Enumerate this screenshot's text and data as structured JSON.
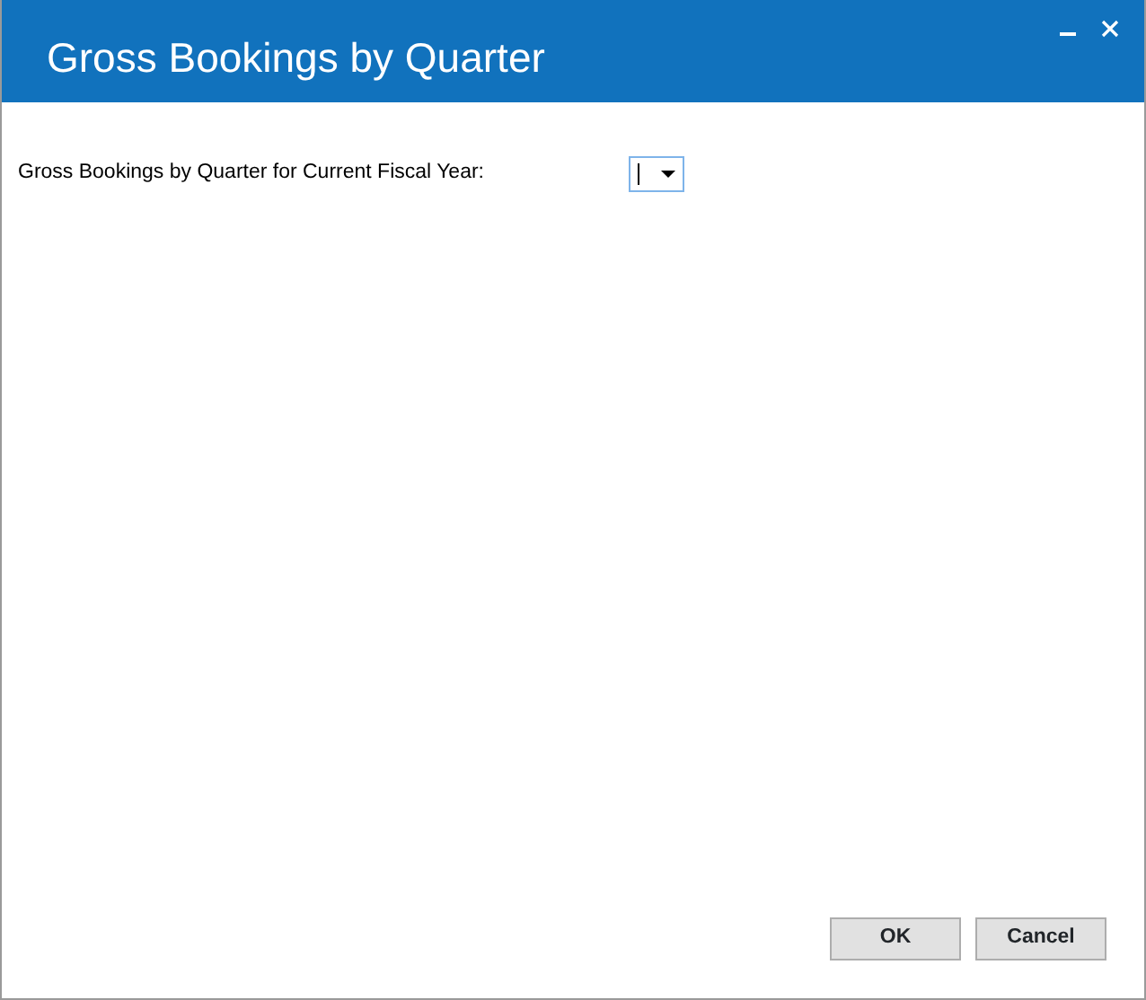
{
  "window": {
    "title": "Gross Bookings by Quarter"
  },
  "form": {
    "label": "Gross Bookings by Quarter for Current Fiscal Year:",
    "dropdown": {
      "focused": true
    }
  },
  "buttons": [
    {
      "label": "OK"
    },
    {
      "label": "Cancel"
    }
  ]
}
